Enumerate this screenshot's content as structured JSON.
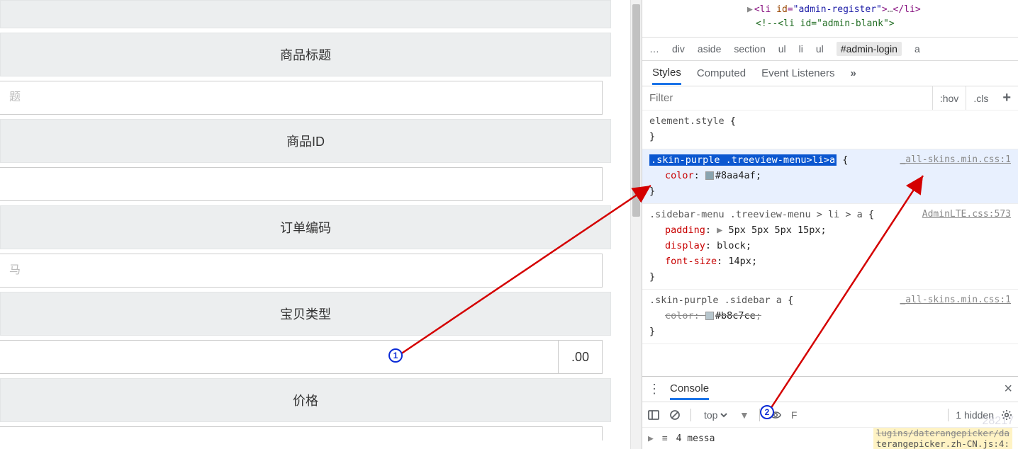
{
  "form": {
    "labels": {
      "title": "商品标题",
      "goods_id": "商品ID",
      "order_code": "订单编码",
      "item_type": "宝贝类型",
      "price": "价格"
    },
    "inputs": {
      "title_placeholder": "题",
      "goods_id_value": "",
      "order_code_placeholder": "马",
      "item_type_value": "",
      "item_type_suffix": ".00"
    }
  },
  "devtools": {
    "dom": {
      "line1_tag": "li",
      "line1_attr_name": "id",
      "line1_attr_val": "admin-register",
      "line1_ellipsis": "…",
      "line2_comment": "<!--<li id=\"admin-blank\">"
    },
    "crumbs": [
      "…",
      "div",
      "aside",
      "section",
      "ul",
      "li",
      "ul",
      "#admin-login",
      "a"
    ],
    "crumb_selected": "#admin-login",
    "subtabs": {
      "styles": "Styles",
      "computed": "Computed",
      "listeners": "Event Listeners",
      "more": "»"
    },
    "filter_placeholder": "Filter",
    "filter_hov": ":hov",
    "filter_cls": ".cls",
    "rules": {
      "element_style": "element.style",
      "r1_selector": ".skin-purple .treeview-menu>li>a",
      "r1_src": "_all-skins.min.css:1",
      "r1_prop_color": "color",
      "r1_val_color": "#8aa4af",
      "r2_selector": ".sidebar-menu .treeview-menu > li > a",
      "r2_src": "AdminLTE.css:573",
      "r2_padding": "padding",
      "r2_padding_val": "5px 5px 5px 15px",
      "r2_display": "display",
      "r2_display_val": "block",
      "r2_fontsize": "font-size",
      "r2_fontsize_val": "14px",
      "r3_selector": ".skin-purple .sidebar a",
      "r3_src": "_all-skins.min.css:1",
      "r3_prop_color": "color",
      "r3_val_color": "#b8c7ce"
    },
    "console": {
      "title": "Console",
      "context": "top",
      "filter_placeholder": "F",
      "hidden_text": "1 hidden",
      "msg_count": "4 messa",
      "link1": "lugins/daterangepicker/da",
      "link2": "terangepicker.zh-CN.js:4:"
    }
  },
  "annotations": {
    "badge1": "1",
    "badge2": "2"
  },
  "watermark": "28217"
}
